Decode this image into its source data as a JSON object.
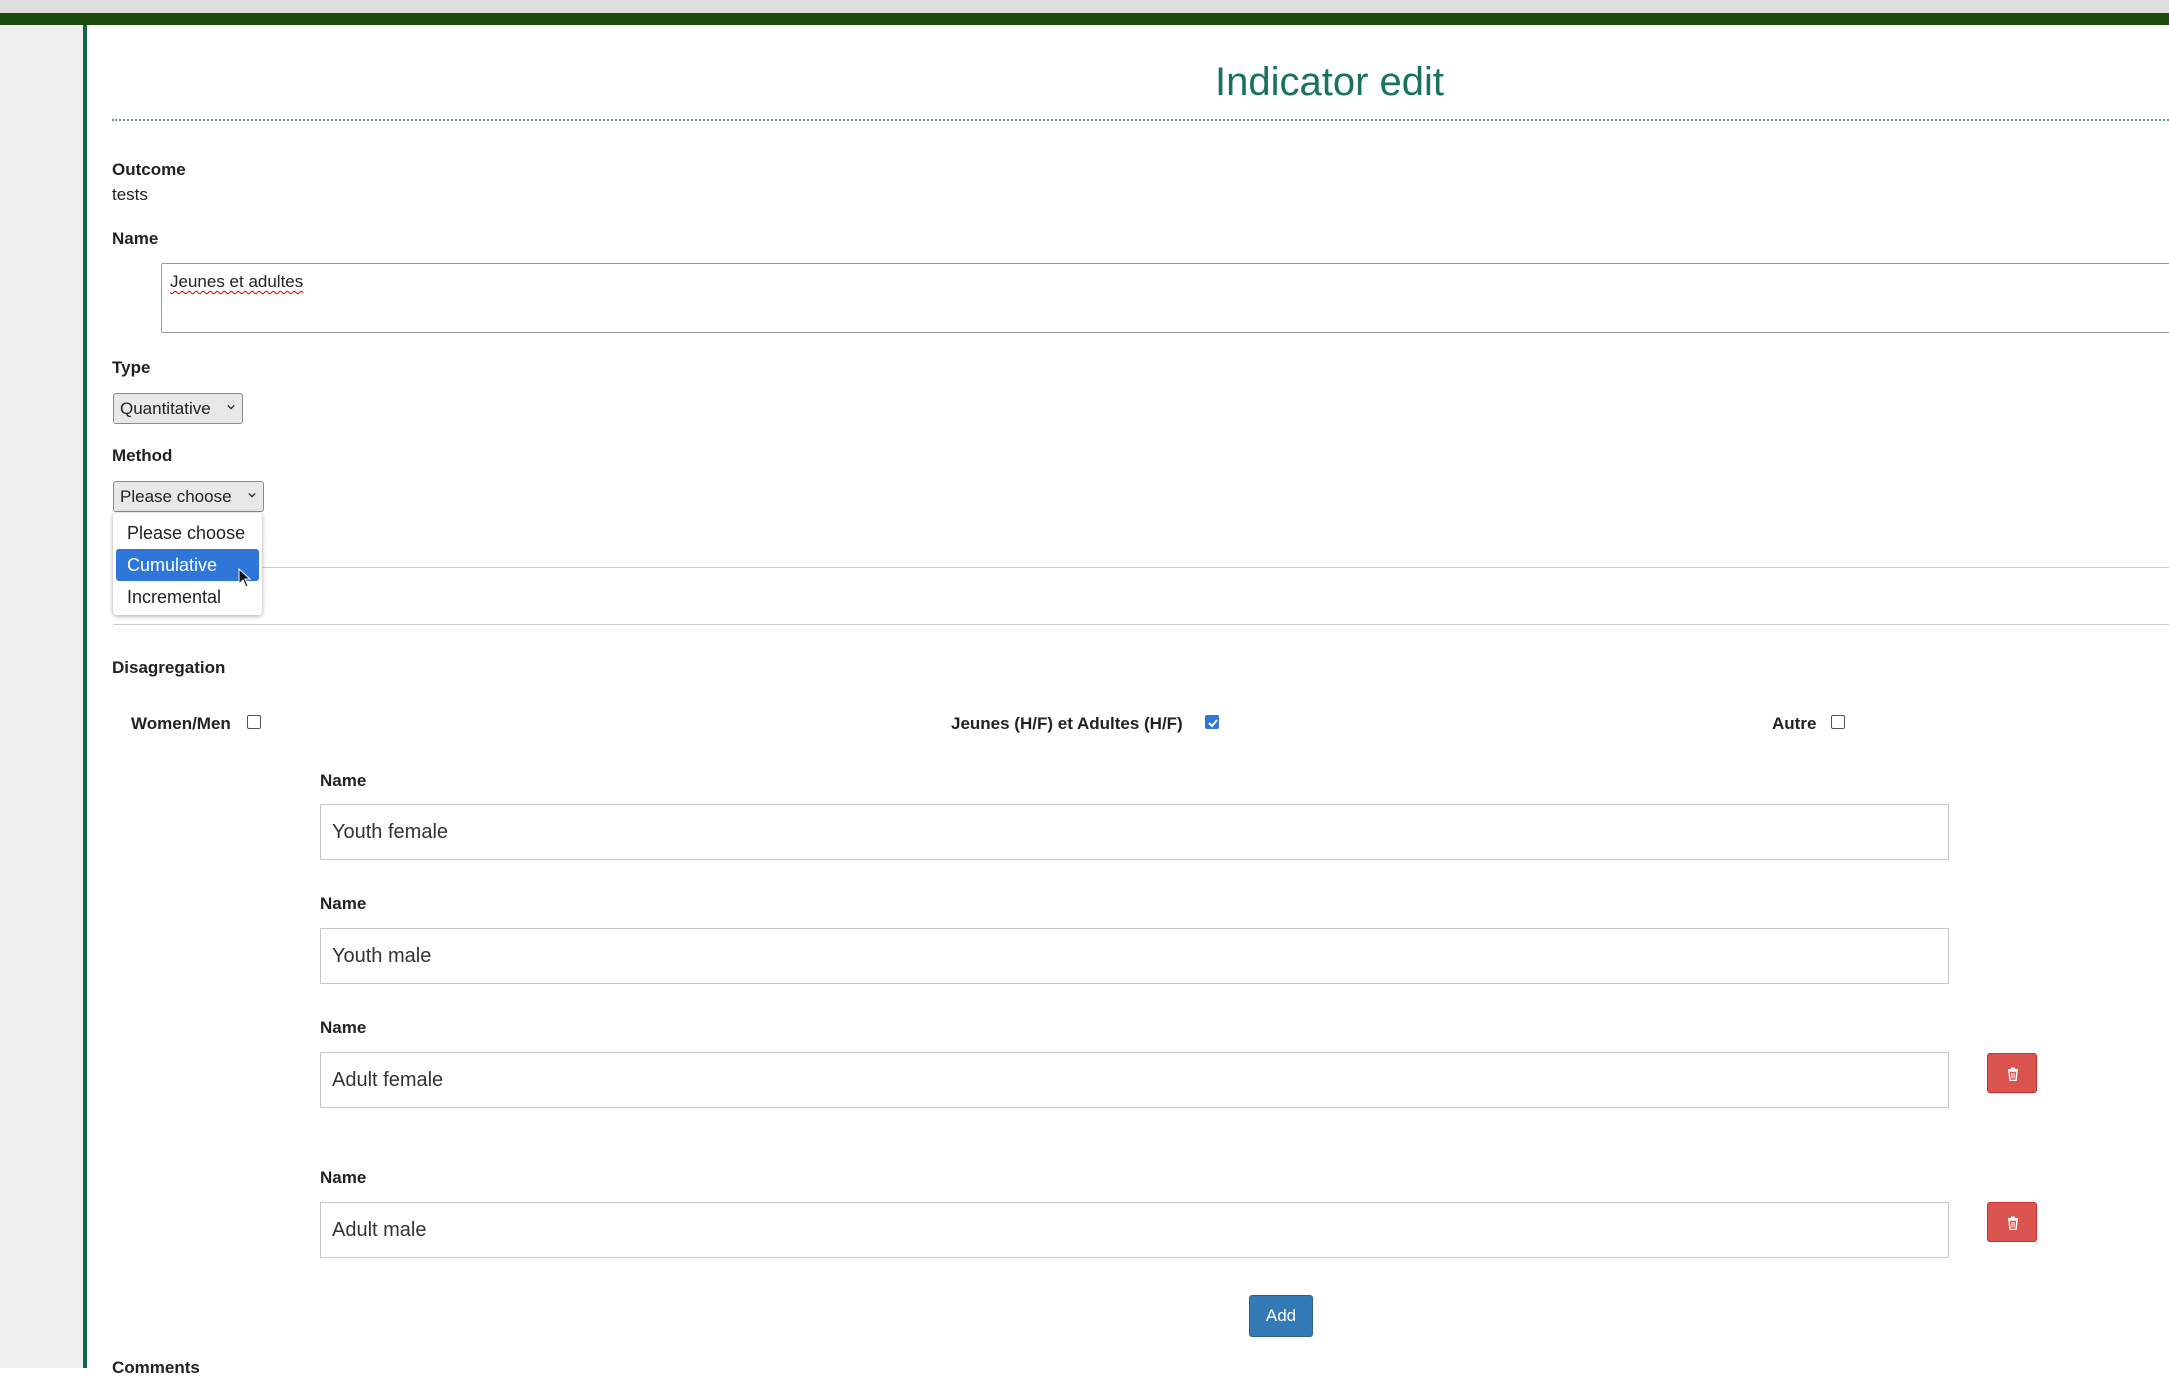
{
  "page": {
    "title": "Indicator edit"
  },
  "outcome": {
    "label": "Outcome",
    "value": "tests"
  },
  "name": {
    "label": "Name",
    "value": "Jeunes et adultes"
  },
  "type": {
    "label": "Type",
    "selected": "Quantitative"
  },
  "method": {
    "label": "Method",
    "selected": "Please choose",
    "options": [
      "Please choose",
      "Cumulative",
      "Incremental"
    ],
    "highlighted": "Cumulative"
  },
  "disaggregation": {
    "label": "Disagregation",
    "options": [
      {
        "label": "Women/Men",
        "checked": false
      },
      {
        "label": "Jeunes (H/F) et Adultes (H/F)",
        "checked": true
      },
      {
        "label": "Autre",
        "checked": false
      }
    ],
    "items": [
      {
        "label": "Name",
        "value": "Youth female"
      },
      {
        "label": "Name",
        "value": "Youth male"
      },
      {
        "label": "Name",
        "value": "Adult female"
      },
      {
        "label": "Name",
        "value": "Adult male"
      }
    ],
    "add_label": "Add"
  },
  "comments": {
    "label": "Comments"
  },
  "colors": {
    "accent": "#18735c",
    "topbar": "#1d4b0c",
    "danger": "#d9534f",
    "primary": "#337ab7",
    "selection": "#2e76d8"
  },
  "icons": {
    "delete": "trash-icon",
    "dropdown": "chevron-down-icon",
    "cursor": "mouse-pointer-icon",
    "checked": "check-icon"
  }
}
